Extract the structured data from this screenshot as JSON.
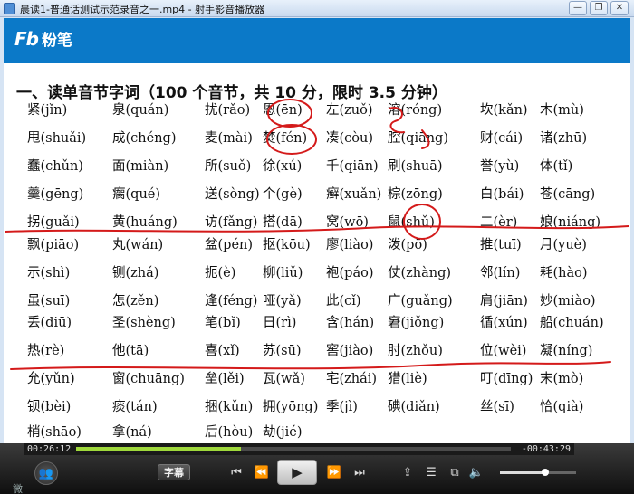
{
  "window": {
    "title": "晨读1-普通话测试示范录音之一.mp4 - 射手影音播放器",
    "minimize_icon": "minimize-icon",
    "restore_icon": "restore-icon",
    "close_icon": "close-icon",
    "minimize_glyph": "—",
    "restore_glyph": "❐",
    "close_glyph": "✕"
  },
  "video": {
    "logo_mark": "Fb",
    "logo_text": "粉笔",
    "heading": "一、读单音节字词（100 个音节，共 10 分，限时 3.5 分钟）",
    "rows": [
      [
        "紧(jǐn)",
        "泉(quán)",
        "扰(rǎo)",
        "恩(ēn)",
        "左(zuǒ)",
        "溶(róng)",
        "坎(kǎn)",
        "木(mù)"
      ],
      [
        "甩(shuǎi)",
        "成(chéng)",
        "麦(mài)",
        "焚(fén)",
        "凑(còu)",
        "腔(qiāng)",
        "财(cái)",
        "诸(zhū)"
      ],
      [
        "蠢(chǔn)",
        "面(miàn)",
        "所(suǒ)",
        "徐(xú)",
        "千(qiān)",
        "刷(shuā)",
        "誉(yù)",
        "体(tǐ)"
      ],
      [
        "羹(gēng)",
        "瘸(qué)",
        "送(sòng)",
        "个(gè)",
        "癣(xuǎn)",
        "棕(zōng)",
        "白(bái)",
        "苍(cāng)"
      ],
      [
        "拐(guǎi)",
        "黄(huáng)",
        "访(fǎng)",
        "搭(dā)",
        "窝(wō)",
        "鼠(shǔ)",
        "二(èr)",
        "娘(niáng)"
      ],
      [
        "飘(piāo)",
        "丸(wán)",
        "盆(pén)",
        "抠(kōu)",
        "廖(liào)",
        "泼(pō)",
        "推(tuī)",
        "月(yuè)"
      ],
      [
        "示(shì)",
        "铡(zhá)",
        "扼(è)",
        "柳(liǔ)",
        "袍(páo)",
        "仗(zhàng)",
        "邻(lín)",
        "耗(hào)"
      ],
      [
        "虽(suī)",
        "怎(zěn)",
        "逢(féng)",
        "哑(yǎ)",
        "此(cǐ)",
        "广(guǎng)",
        "肩(jiān)",
        "妙(miào)"
      ],
      [
        "丢(diū)",
        "圣(shèng)",
        "笔(bǐ)",
        "日(rì)",
        "含(hán)",
        "窘(jiǒng)",
        "循(xún)",
        "船(chuán)"
      ],
      [
        "热(rè)",
        "他(tā)",
        "喜(xǐ)",
        "苏(sū)",
        "窖(jiào)",
        "肘(zhǒu)",
        "位(wèi)",
        "凝(níng)"
      ],
      [
        "允(yǔn)",
        "窗(chuāng)",
        "垒(lěi)",
        "瓦(wǎ)",
        "宅(zhái)",
        "猎(liè)",
        "叮(dīng)",
        "末(mò)"
      ],
      [
        "钡(bèi)",
        "痰(tán)",
        "捆(kǔn)",
        "拥(yōng)",
        "季(jì)",
        "碘(diǎn)",
        "丝(sī)",
        "恰(qià)"
      ],
      [
        "梢(shāo)",
        "拿(ná)",
        "后(hòu)",
        "劫(jié)"
      ]
    ]
  },
  "player": {
    "elapsed": "00:26:12",
    "remaining": "-00:43:29",
    "progress_fraction": 0.38,
    "volume_fraction": 0.6,
    "subtitle_label": "字幕",
    "watermark": "微",
    "icons": {
      "user": "user-group-icon",
      "prev": "skip-back-icon",
      "rewind": "rewind-icon",
      "play": "play-icon",
      "forward": "fast-forward-icon",
      "next": "skip-forward-icon",
      "open": "open-file-icon",
      "playlist": "playlist-icon",
      "settings": "screen-settings-icon",
      "volume": "volume-icon"
    },
    "glyphs": {
      "user": "👥",
      "prev": "⏮",
      "rewind": "⏪",
      "play": "▶",
      "forward": "⏩",
      "next": "⏭",
      "open": "⇪",
      "playlist": "☰",
      "settings": "⧉",
      "volume": "🔈"
    }
  },
  "colors": {
    "brand_blue": "#0b79c8",
    "annotation_red": "#d41a1a",
    "progress_green": "#9fd83b"
  }
}
